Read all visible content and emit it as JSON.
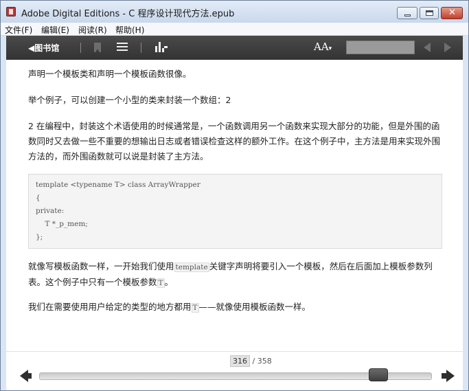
{
  "window": {
    "title": "Adobe Digital Editions - C  程序设计现代方法.epub",
    "icon": "adobe-de-icon",
    "controls": {
      "minimize": "minimize-icon",
      "maximize": "maximize-icon",
      "close_glyph": "✕"
    }
  },
  "menu": {
    "items": [
      "文件(F)",
      "编辑(E)",
      "阅读(R)",
      "帮助(H)"
    ]
  },
  "toolbar": {
    "library_label": "◀图书馆",
    "font_size_label": "AA",
    "font_size_caret": "▾",
    "search_value": "",
    "icons": [
      "bookmark-icon",
      "toc-list-icon",
      "stats-chart-icon",
      "prev-result-icon",
      "next-result-icon"
    ]
  },
  "content": {
    "p1": "声明一个模板类和声明一个模板函数很像。",
    "p2": "举个例子，可以创建一个小型的类来封装一个数组：2",
    "p3": "2 在编程中，封装这个术语使用的时候通常是，一个函数调用另一个函数来实现大部分的功能，但是外围的函数同时又去做一些不重要的想输出日志或者错误检查这样的额外工作。在这个例子中，主方法是用来实现外围方法的，而外围函数就可以说是封装了主方法。",
    "code": [
      "template <typename T> class ArrayWrapper",
      "{",
      "private:",
      "    T *_p_mem;",
      "};"
    ],
    "p4_a": "就像写模板函数一样，一开始我们使用",
    "p4_code": "template",
    "p4_b": "关键字声明将要引入一个模板，然后在后面加上模板参数列表。这个例子中只有一个模板参数",
    "p4_code2": "T",
    "p4_c": "。",
    "p5_a": "我们在需要使用用户给定的类型的地方都用",
    "p5_code": "T",
    "p5_b": "——就像使用模板函数一样。"
  },
  "pager": {
    "current_page": "316",
    "total_label": "/ 358",
    "progress": 0.882,
    "colors": {
      "toolbar": "#3a3a3a",
      "thumb": "#4a4a4a"
    }
  }
}
